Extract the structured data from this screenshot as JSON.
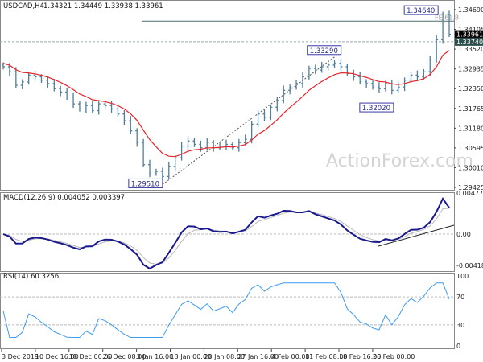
{
  "header": {
    "symbol": "USDCAD,H4",
    "ohlc": "1.34321 1.34449 1.33938 1.33961"
  },
  "colors": {
    "bars": "#4f7f9a",
    "ma": "#e8242a",
    "macd": "#1a1a8c",
    "signal": "#b8b8b8",
    "rsi": "#3d9bf0",
    "label_border": "#3a3aa8"
  },
  "watermark": "ActionForex.com",
  "chart_data": [
    {
      "type": "ohlc",
      "title": "USDCAD,H4",
      "price_axis": [
        "1.34690",
        "1.34105",
        "1.33520",
        "1.32935",
        "1.32350",
        "1.31765",
        "1.31180",
        "1.30595",
        "1.30010",
        "1.29425"
      ],
      "ylim": [
        1.29425,
        1.3469
      ],
      "current_price": "1.33961",
      "level_price": "1.33740",
      "level_value": 1.3374,
      "fe_level_value": 1.3435,
      "fe_label": "FE 61.8",
      "closes": [
        1.33,
        1.3285,
        1.3245,
        1.3255,
        1.3275,
        1.327,
        1.326,
        1.325,
        1.3235,
        1.3225,
        1.321,
        1.319,
        1.3175,
        1.3185,
        1.317,
        1.319,
        1.3185,
        1.3175,
        1.316,
        1.314,
        1.311,
        1.3075,
        1.301,
        1.2985,
        1.299,
        1.2975,
        1.3005,
        1.303,
        1.3065,
        1.308,
        1.307,
        1.306,
        1.3075,
        1.306,
        1.3065,
        1.307,
        1.306,
        1.3075,
        1.3085,
        1.313,
        1.316,
        1.315,
        1.318,
        1.32,
        1.323,
        1.324,
        1.325,
        1.327,
        1.3295,
        1.329,
        1.33,
        1.3305,
        1.331,
        1.33,
        1.328,
        1.327,
        1.3255,
        1.325,
        1.324,
        1.3235,
        1.325,
        1.323,
        1.324,
        1.326,
        1.3275,
        1.327,
        1.3285,
        1.332,
        1.338,
        1.3455,
        1.3396
      ],
      "annotations": [
        {
          "text": "1.29510",
          "value": 1.2951,
          "index": 25
        },
        {
          "text": "1.33290",
          "value": 1.3329,
          "index": 50
        },
        {
          "text": "1.32020",
          "value": 1.3202,
          "index": 60
        },
        {
          "text": "1.34640",
          "value": 1.3464,
          "index": 68
        }
      ],
      "trendline": {
        "from_index": 25,
        "from_value": 1.2951,
        "to_index": 52,
        "to_value": 1.3329
      }
    },
    {
      "type": "line",
      "title": "MACD(12,26,9) 0.004052 0.003397",
      "axis": [
        "0.004772",
        "0.00",
        "-0.004186"
      ],
      "ylim": [
        -0.004186,
        0.004772
      ]
    },
    {
      "type": "line",
      "title": "RSI(14) 60.3256",
      "axis": [
        "100",
        "70",
        "30",
        "0"
      ],
      "ylim": [
        0,
        100
      ]
    }
  ],
  "x_axis": [
    "3 Dec 2019",
    "10 Dec 16:00",
    "18 Dec 00:00",
    "26 Dec 08:00",
    "3 Jan 16:00",
    "13 Jan 00:00",
    "20 Jan 08:00",
    "27 Jan 16:00",
    "4 Feb 00:00",
    "11 Feb 08:00",
    "18 Feb 16:00",
    "26 Feb 00:00"
  ]
}
